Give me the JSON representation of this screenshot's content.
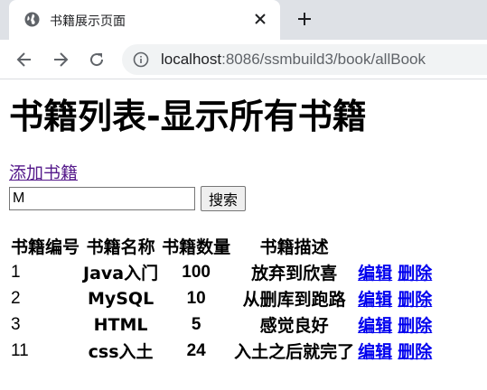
{
  "browser": {
    "tab_title": "书籍展示页面",
    "url_host": "localhost",
    "url_path": ":8086/ssmbuild3/book/allBook"
  },
  "page": {
    "title": "书籍列表-显示所有书籍",
    "add_link": "添加书籍",
    "search": {
      "value": "M",
      "button": "搜索"
    },
    "table": {
      "headers": [
        "书籍编号",
        "书籍名称",
        "书籍数量",
        "书籍描述"
      ],
      "rows": [
        {
          "id": "1",
          "name": "Java入门",
          "count": "100",
          "desc": "放弃到欣喜",
          "edit": "编辑",
          "delete": "删除"
        },
        {
          "id": "2",
          "name": "MySQL",
          "count": "10",
          "desc": "从删库到跑路",
          "edit": "编辑",
          "delete": "删除"
        },
        {
          "id": "3",
          "name": "HTML",
          "count": "5",
          "desc": "感觉良好",
          "edit": "编辑",
          "delete": "删除"
        },
        {
          "id": "11",
          "name": "css入土",
          "count": "24",
          "desc": "入土之后就完了",
          "edit": "编辑",
          "delete": "删除"
        }
      ]
    }
  },
  "colors": {
    "link": "#0000ee",
    "visited_link": "#551a8b",
    "tabstrip": "#dee1e6",
    "omnibox": "#f1f3f4"
  },
  "icons": [
    "globe-icon",
    "close-icon",
    "plus-icon",
    "back-arrow-icon",
    "forward-arrow-icon",
    "reload-icon",
    "info-icon"
  ]
}
